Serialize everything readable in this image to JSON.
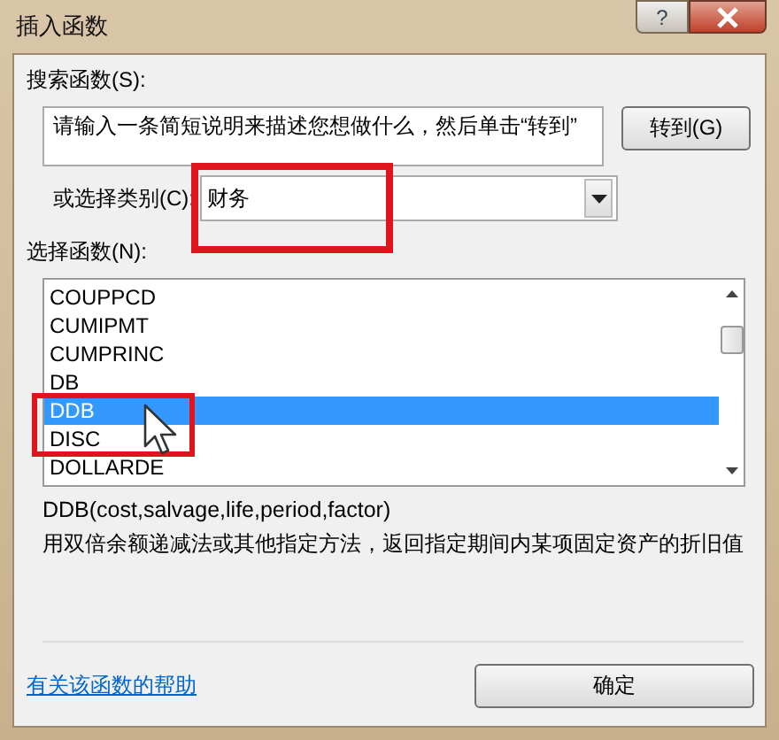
{
  "window": {
    "title": "插入函数",
    "help_button": "?"
  },
  "search": {
    "label": "搜索函数(S):",
    "value": "请输入一条简短说明来描述您想做什么，然后单击“转到”",
    "go_button": "转到(G)"
  },
  "category": {
    "label": "或选择类别(C):",
    "value": "财务"
  },
  "functions": {
    "label": "选择函数(N):",
    "items": [
      {
        "name": "COUPPCD",
        "selected": false
      },
      {
        "name": "CUMIPMT",
        "selected": false
      },
      {
        "name": "CUMPRINC",
        "selected": false
      },
      {
        "name": "DB",
        "selected": false
      },
      {
        "name": "DDB",
        "selected": true
      },
      {
        "name": "DISC",
        "selected": false
      },
      {
        "name": "DOLLARDE",
        "selected": false
      }
    ]
  },
  "syntax": "DDB(cost,salvage,life,period,factor)",
  "description": "用双倍余额递减法或其他指定方法，返回指定期间内某项固定资产的折旧值",
  "help_link": "有关该函数的帮助",
  "ok_button": "确定"
}
